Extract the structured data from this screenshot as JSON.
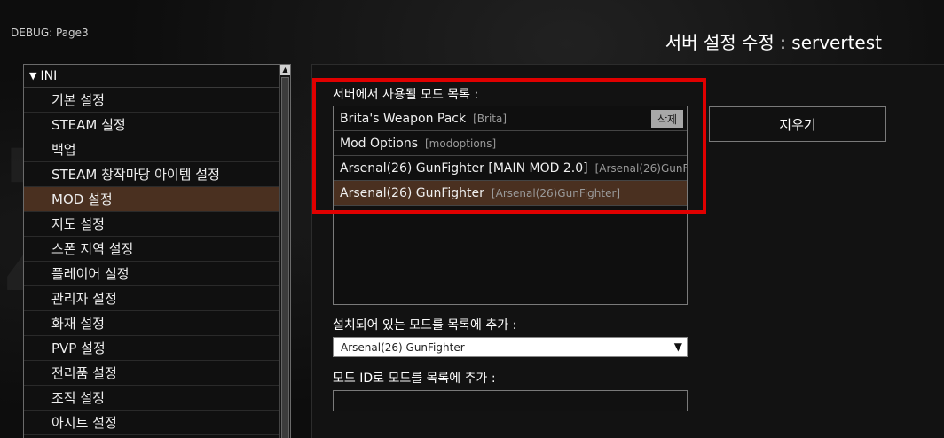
{
  "debug_label": "DEBUG: Page3",
  "page_title": "서버 설정 수정 : servertest",
  "tree": {
    "header": "INI",
    "items": [
      {
        "label": "기본 설정",
        "selected": false
      },
      {
        "label": "STEAM 설정",
        "selected": false
      },
      {
        "label": "백업",
        "selected": false
      },
      {
        "label": "STEAM 창작마당 아이템 설정",
        "selected": false
      },
      {
        "label": "MOD 설정",
        "selected": true
      },
      {
        "label": "지도 설정",
        "selected": false
      },
      {
        "label": "스폰 지역 설정",
        "selected": false
      },
      {
        "label": "플레이어 설정",
        "selected": false
      },
      {
        "label": "관리자 설정",
        "selected": false
      },
      {
        "label": "화재 설정",
        "selected": false
      },
      {
        "label": "PVP 설정",
        "selected": false
      },
      {
        "label": "전리품 설정",
        "selected": false
      },
      {
        "label": "조직 설정",
        "selected": false
      },
      {
        "label": "아지트 설정",
        "selected": false
      }
    ]
  },
  "mods_section": {
    "label": "서버에서 사용될 모드 목록 :",
    "delete_label": "삭제",
    "items": [
      {
        "name": "Brita's Weapon Pack",
        "id": "[Brita]",
        "selected": false
      },
      {
        "name": "Mod Options",
        "id": "[modoptions]",
        "selected": false
      },
      {
        "name": "Arsenal(26) GunFighter [MAIN MOD 2.0]",
        "id": "[Arsenal(26)GunFigh",
        "selected": false
      },
      {
        "name": "Arsenal(26) GunFighter",
        "id": "[Arsenal(26)GunFighter]",
        "selected": true
      }
    ]
  },
  "clear_button": "지우기",
  "add_installed": {
    "label": "설치되어 있는 모드를 목록에 추가 :",
    "selected_value": "Arsenal(26) GunFighter"
  },
  "add_by_id": {
    "label": "모드 ID로 모드를 목록에 추가 :",
    "value": ""
  },
  "colors": {
    "selected_row": "#4a3020",
    "highlight_border": "#e00000"
  }
}
